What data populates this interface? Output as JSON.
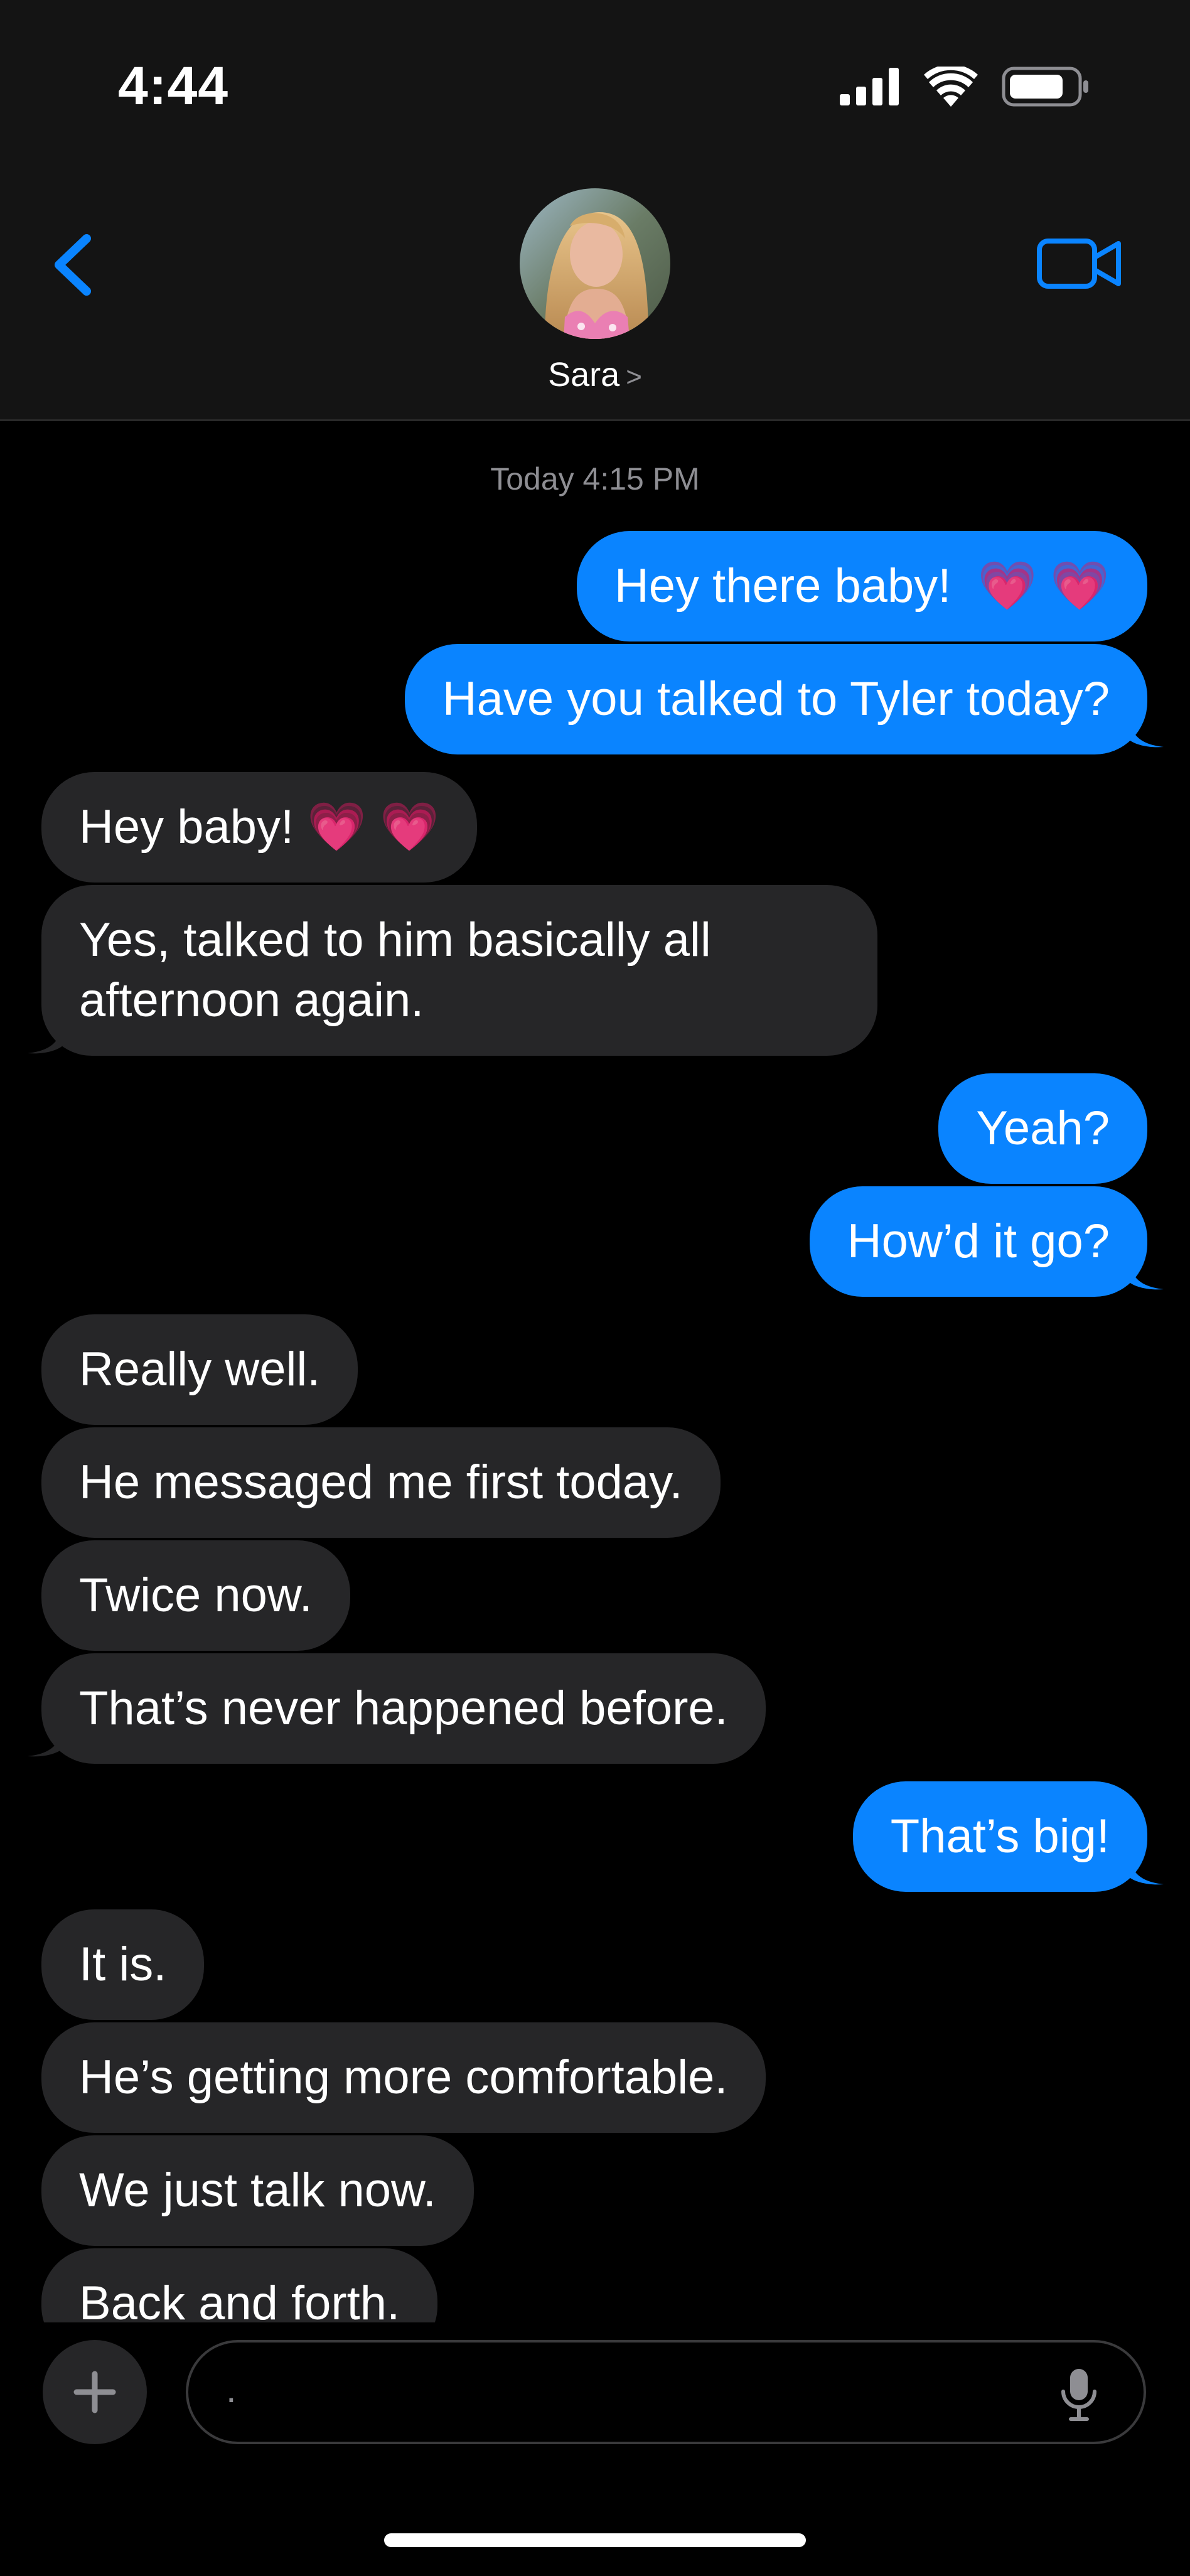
{
  "status_bar": {
    "time": "4:44"
  },
  "nav": {
    "contact_name": "Sara",
    "chevron": ">"
  },
  "conversation": {
    "timestamp": "Today 4:15 PM",
    "messages": [
      {
        "from": "me",
        "text": "Hey there baby!",
        "emoji": "💗 💗"
      },
      {
        "from": "me",
        "text": "Have you talked to Tyler today?"
      },
      {
        "from": "them",
        "text": "Hey baby!",
        "emoji": "💗 💗"
      },
      {
        "from": "them",
        "text": "Yes, talked to him basically all afternoon again."
      },
      {
        "from": "me",
        "text": "Yeah?"
      },
      {
        "from": "me",
        "text": "How’d it go?"
      },
      {
        "from": "them",
        "text": "Really well."
      },
      {
        "from": "them",
        "text": "He messaged me first today."
      },
      {
        "from": "them",
        "text": "Twice now."
      },
      {
        "from": "them",
        "text": "That’s never happened before."
      },
      {
        "from": "me",
        "text": "That’s big!"
      },
      {
        "from": "them",
        "text": "It is."
      },
      {
        "from": "them",
        "text": "He’s getting more comfortable."
      },
      {
        "from": "them",
        "text": "We just talk now."
      },
      {
        "from": "them",
        "text": "Back and forth."
      }
    ]
  },
  "composer": {
    "value": "."
  },
  "colors": {
    "sent_bubble": "#0a84ff",
    "received_bubble": "#262628",
    "accent": "#0a84ff",
    "background": "#000000"
  }
}
